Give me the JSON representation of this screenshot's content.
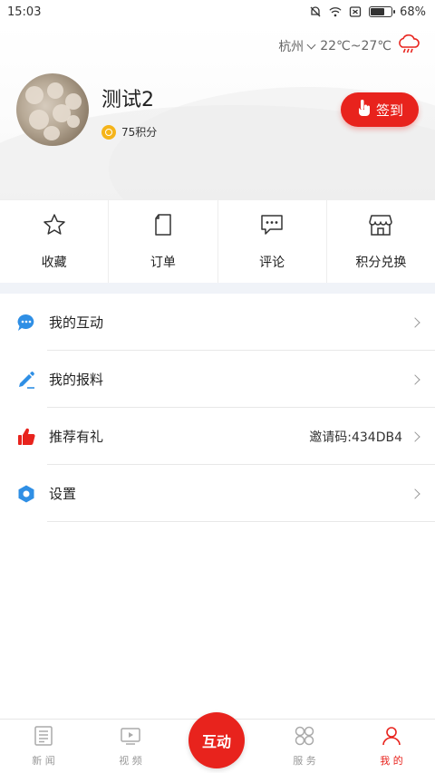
{
  "status_bar": {
    "time": "15:03",
    "battery": "68%",
    "battery_level": 0.68
  },
  "header": {
    "city": "杭州",
    "temperature": "22℃~27℃",
    "weather_icon": "rain-cloud-icon",
    "username": "测试2",
    "points": "75积分",
    "signin_label": "签到"
  },
  "quick_menu": [
    {
      "label": "收藏",
      "icon": "star-icon"
    },
    {
      "label": "订单",
      "icon": "document-icon"
    },
    {
      "label": "评论",
      "icon": "comment-icon"
    },
    {
      "label": "积分兑换",
      "icon": "store-icon"
    }
  ],
  "menu": [
    {
      "label": "我的互动",
      "icon": "chat-bubble-icon",
      "value": ""
    },
    {
      "label": "我的报料",
      "icon": "pen-icon",
      "value": ""
    },
    {
      "label": "推荐有礼",
      "icon": "thumbs-up-icon",
      "value": "邀请码:434DB4"
    },
    {
      "label": "设置",
      "icon": "settings-hex-icon",
      "value": ""
    }
  ],
  "bottom_nav": {
    "items": [
      {
        "label": "新 闻",
        "icon": "newspaper-icon"
      },
      {
        "label": "视 频",
        "icon": "video-icon"
      },
      {
        "label": "服 务",
        "icon": "services-icon"
      },
      {
        "label": "我 的",
        "icon": "user-icon"
      }
    ],
    "center_label": "互动",
    "active": "我 的"
  },
  "colors": {
    "accent": "#e8231d",
    "coin": "#f5b41a",
    "interaction_blue": "#2f8fe5"
  }
}
